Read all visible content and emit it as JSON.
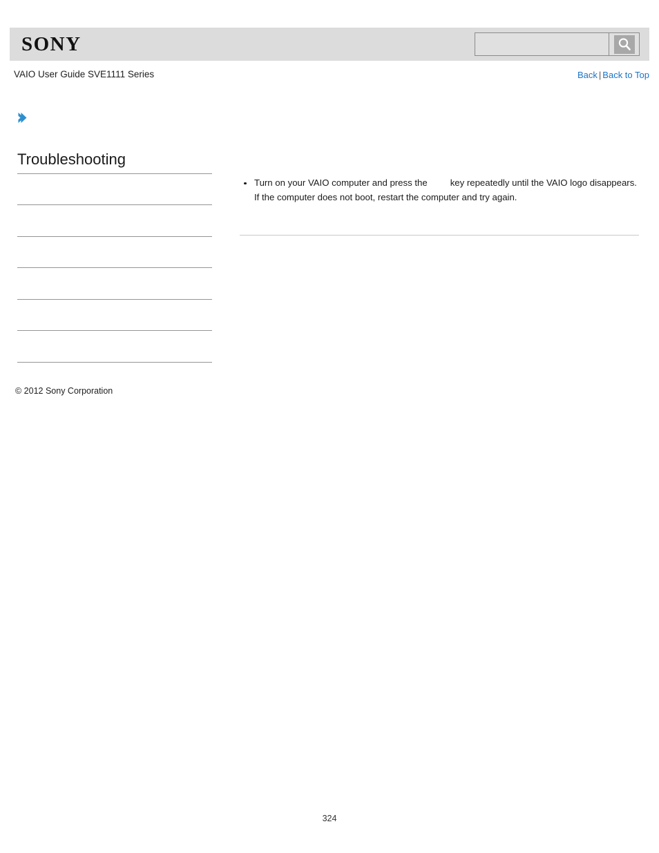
{
  "header": {
    "logo_text": "SONY",
    "search": {
      "value": "",
      "placeholder": "",
      "icon": "search-icon",
      "button_label": ""
    }
  },
  "sub_header": {
    "guide_title": "VAIO User Guide SVE1111 Series",
    "links": {
      "back": "Back",
      "separator": "|",
      "back_to_top": "Back to Top"
    },
    "link_color": "#1a73c8"
  },
  "breadcrumb": {
    "icon": "chevron-right-icon",
    "icon_color": "#2f8fce",
    "text": ""
  },
  "sidebar": {
    "title": "Troubleshooting",
    "items": [
      {
        "label": ""
      },
      {
        "label": ""
      },
      {
        "label": ""
      },
      {
        "label": ""
      },
      {
        "label": ""
      },
      {
        "label": ""
      }
    ]
  },
  "main": {
    "bullets": [
      {
        "text_before_key": "Turn on your VAIO computer and press the",
        "key_image": "",
        "text_after_key": "key repeatedly until the VAIO logo disappears.",
        "extra_line": "If the computer does not boot, restart the computer and try again."
      }
    ]
  },
  "footer": {
    "copyright": "© 2012 Sony Corporation",
    "page_number": "324"
  },
  "colors": {
    "header_bar": "#dcdcdc",
    "page_background": "#ffffff",
    "rule": "#949494",
    "content_rule": "#c9c9c9",
    "link": "#1a73c8",
    "accent_blue": "#2f8fce"
  }
}
